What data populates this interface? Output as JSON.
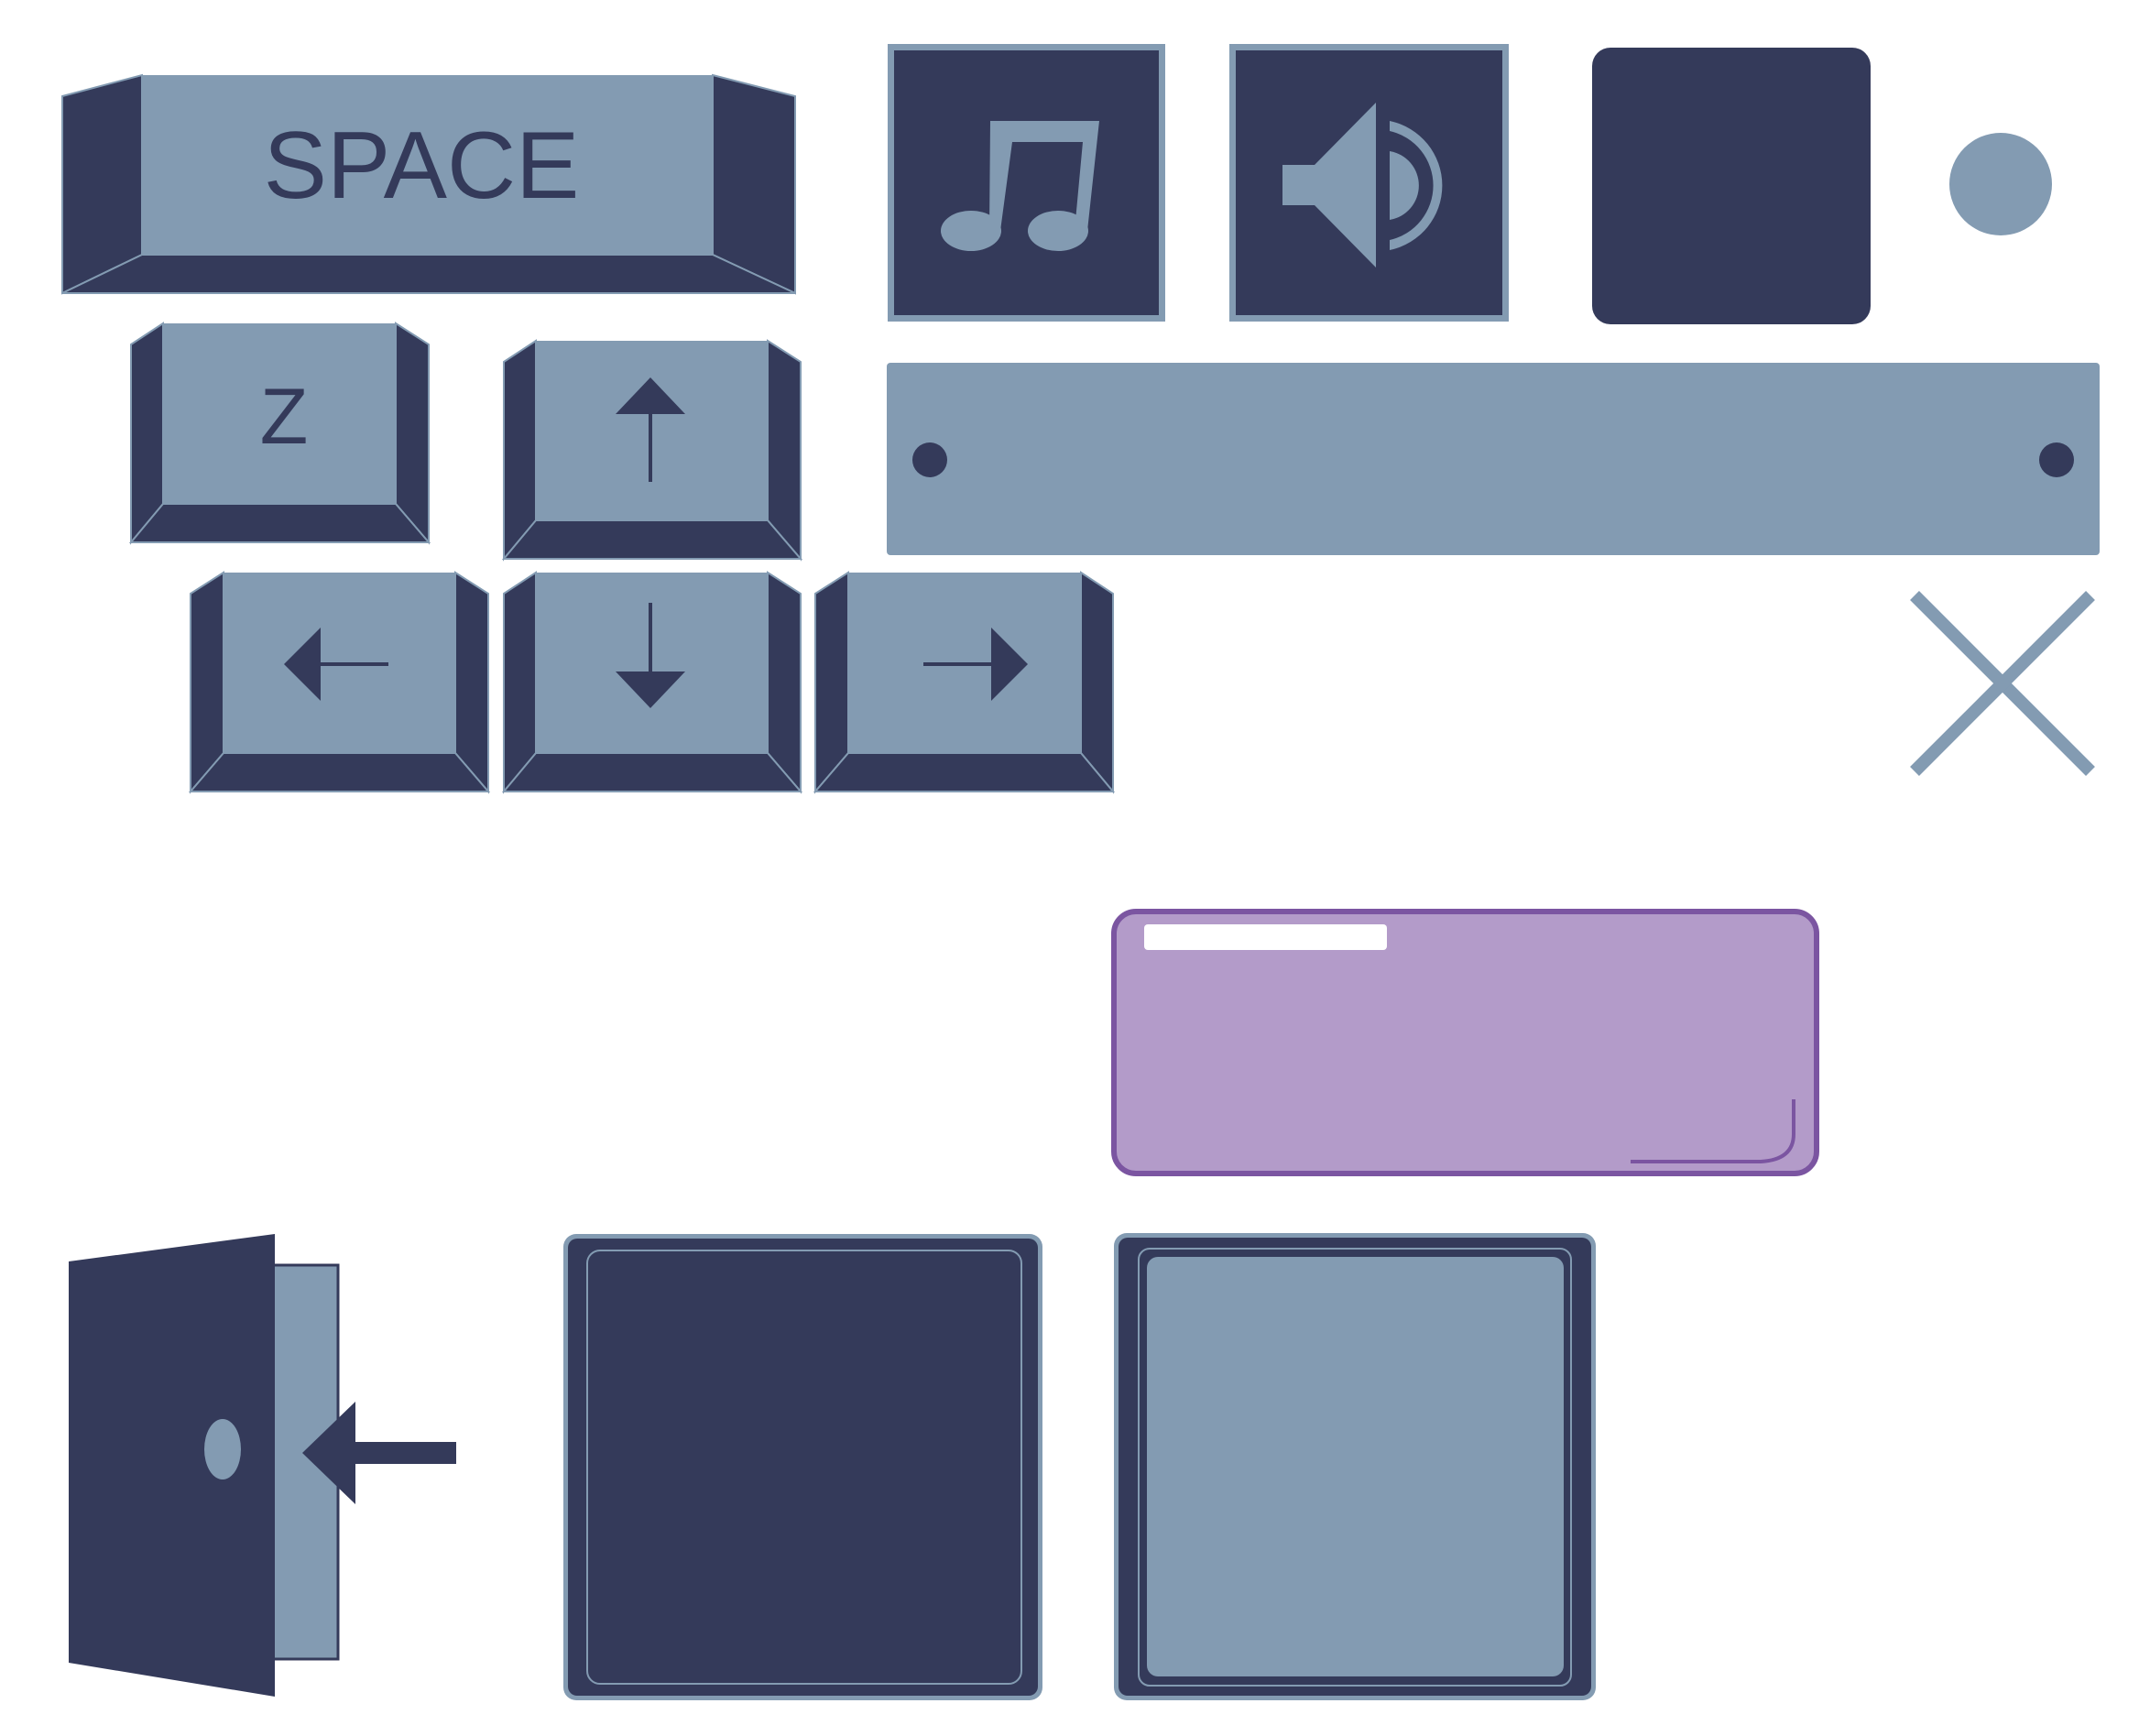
{
  "colors": {
    "navy": "#343a5a",
    "slate": "#839bb2",
    "purple_fill": "#b39bc9",
    "purple_border": "#7b55a1",
    "white": "#ffffff"
  },
  "keys": {
    "space_label": "SPACE",
    "z_label": "Z"
  },
  "icons": {
    "up": "arrow-up-icon",
    "left": "arrow-left-icon",
    "down": "arrow-down-icon",
    "right": "arrow-right-icon",
    "music": "music-note-icon",
    "sound": "speaker-sound-icon",
    "close": "close-icon",
    "exit": "exit-door-icon"
  }
}
